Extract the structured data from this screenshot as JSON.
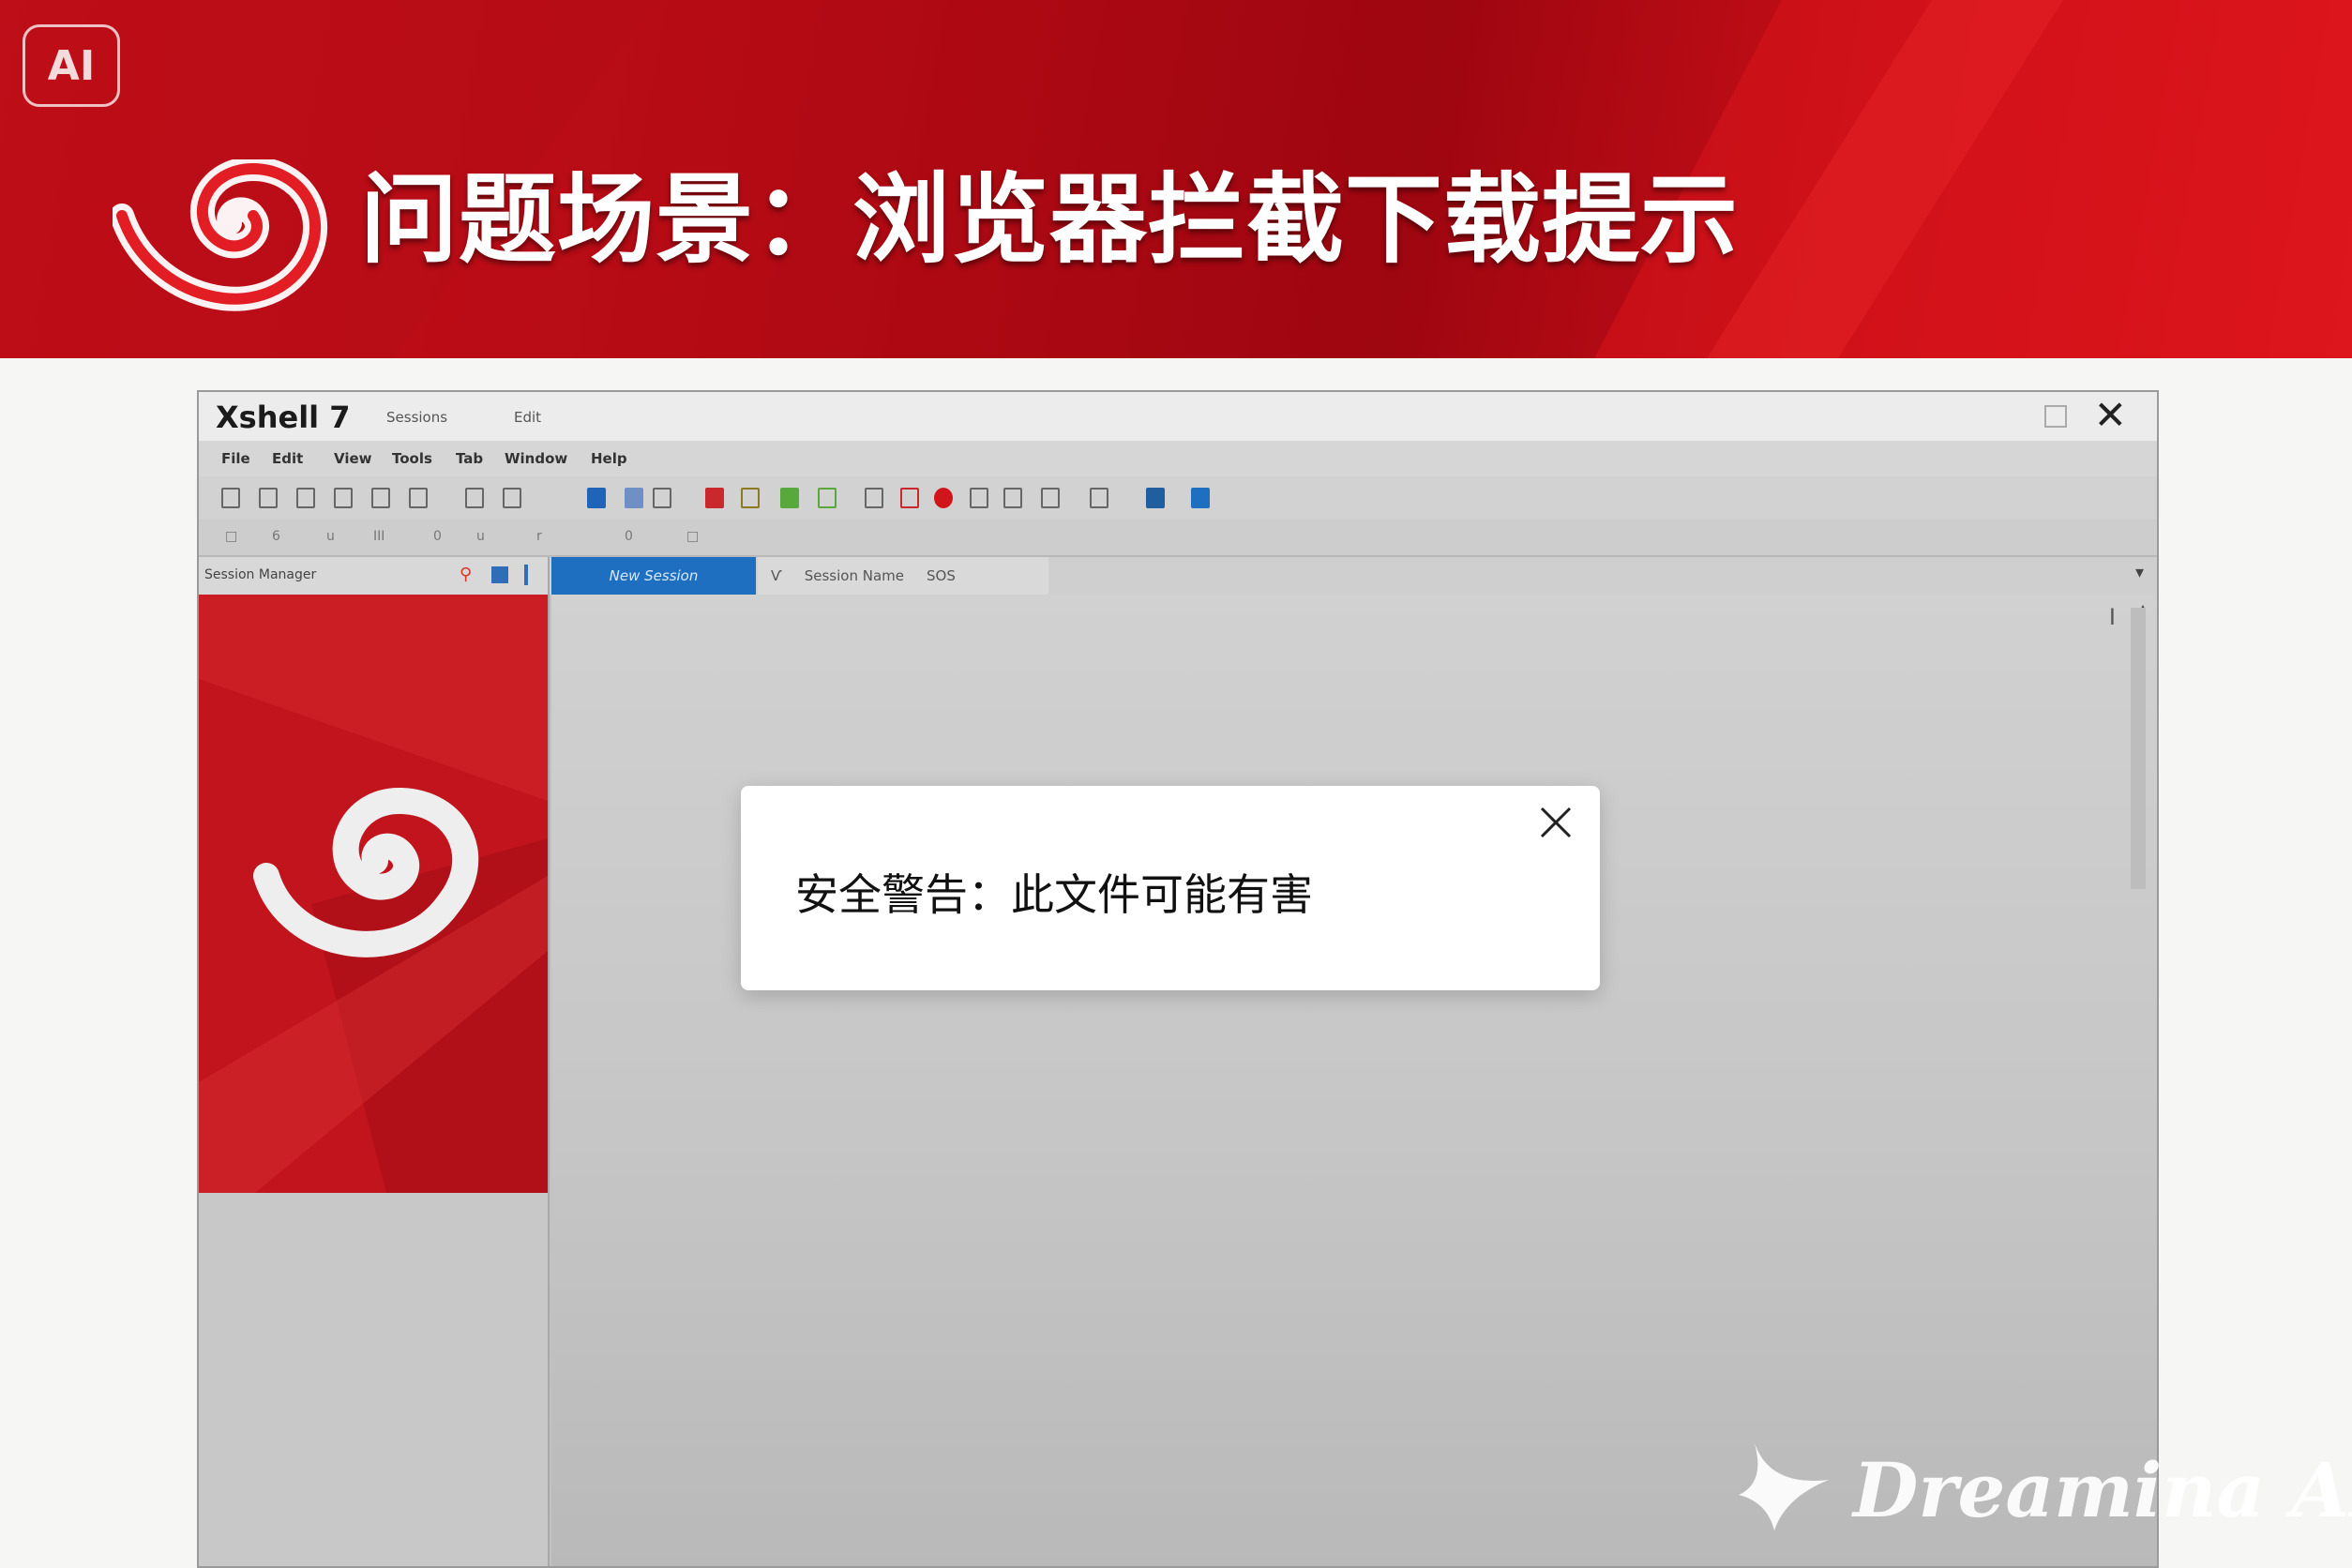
{
  "slide": {
    "badge": "AI",
    "title": "问题场景：浏览器拦截下载提示"
  },
  "window": {
    "app_title": "Xshell 7",
    "title_menus": [
      "Sessions",
      "Edit"
    ],
    "menus": [
      "File",
      "Edit",
      "View",
      "Tools",
      "Tab",
      "Window",
      "Help"
    ]
  },
  "tabs": {
    "session_header": "Session Manager",
    "active_tab": "New Session",
    "inactive_tab": "Session Name",
    "inactive_tab_extra": "SOS"
  },
  "dialog": {
    "message": "安全警告：此文件可能有害"
  },
  "watermark": {
    "text": "Dreamina AI"
  },
  "colors": {
    "brand_red": "#c1141c",
    "tab_blue": "#1f6fc1",
    "dialog_bg": "#ffffff"
  }
}
